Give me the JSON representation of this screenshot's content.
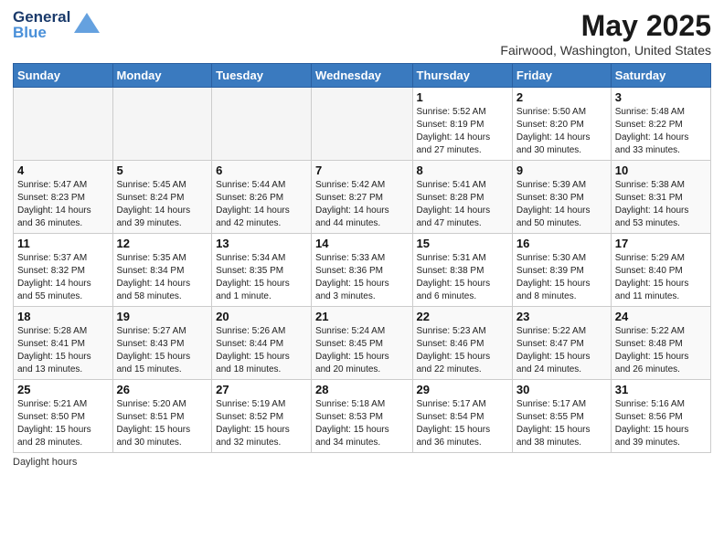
{
  "header": {
    "logo_line1": "General",
    "logo_line2": "Blue",
    "title": "May 2025",
    "subtitle": "Fairwood, Washington, United States"
  },
  "days_of_week": [
    "Sunday",
    "Monday",
    "Tuesday",
    "Wednesday",
    "Thursday",
    "Friday",
    "Saturday"
  ],
  "weeks": [
    [
      {
        "day": "",
        "info": ""
      },
      {
        "day": "",
        "info": ""
      },
      {
        "day": "",
        "info": ""
      },
      {
        "day": "",
        "info": ""
      },
      {
        "day": "1",
        "info": "Sunrise: 5:52 AM\nSunset: 8:19 PM\nDaylight: 14 hours\nand 27 minutes."
      },
      {
        "day": "2",
        "info": "Sunrise: 5:50 AM\nSunset: 8:20 PM\nDaylight: 14 hours\nand 30 minutes."
      },
      {
        "day": "3",
        "info": "Sunrise: 5:48 AM\nSunset: 8:22 PM\nDaylight: 14 hours\nand 33 minutes."
      }
    ],
    [
      {
        "day": "4",
        "info": "Sunrise: 5:47 AM\nSunset: 8:23 PM\nDaylight: 14 hours\nand 36 minutes."
      },
      {
        "day": "5",
        "info": "Sunrise: 5:45 AM\nSunset: 8:24 PM\nDaylight: 14 hours\nand 39 minutes."
      },
      {
        "day": "6",
        "info": "Sunrise: 5:44 AM\nSunset: 8:26 PM\nDaylight: 14 hours\nand 42 minutes."
      },
      {
        "day": "7",
        "info": "Sunrise: 5:42 AM\nSunset: 8:27 PM\nDaylight: 14 hours\nand 44 minutes."
      },
      {
        "day": "8",
        "info": "Sunrise: 5:41 AM\nSunset: 8:28 PM\nDaylight: 14 hours\nand 47 minutes."
      },
      {
        "day": "9",
        "info": "Sunrise: 5:39 AM\nSunset: 8:30 PM\nDaylight: 14 hours\nand 50 minutes."
      },
      {
        "day": "10",
        "info": "Sunrise: 5:38 AM\nSunset: 8:31 PM\nDaylight: 14 hours\nand 53 minutes."
      }
    ],
    [
      {
        "day": "11",
        "info": "Sunrise: 5:37 AM\nSunset: 8:32 PM\nDaylight: 14 hours\nand 55 minutes."
      },
      {
        "day": "12",
        "info": "Sunrise: 5:35 AM\nSunset: 8:34 PM\nDaylight: 14 hours\nand 58 minutes."
      },
      {
        "day": "13",
        "info": "Sunrise: 5:34 AM\nSunset: 8:35 PM\nDaylight: 15 hours\nand 1 minute."
      },
      {
        "day": "14",
        "info": "Sunrise: 5:33 AM\nSunset: 8:36 PM\nDaylight: 15 hours\nand 3 minutes."
      },
      {
        "day": "15",
        "info": "Sunrise: 5:31 AM\nSunset: 8:38 PM\nDaylight: 15 hours\nand 6 minutes."
      },
      {
        "day": "16",
        "info": "Sunrise: 5:30 AM\nSunset: 8:39 PM\nDaylight: 15 hours\nand 8 minutes."
      },
      {
        "day": "17",
        "info": "Sunrise: 5:29 AM\nSunset: 8:40 PM\nDaylight: 15 hours\nand 11 minutes."
      }
    ],
    [
      {
        "day": "18",
        "info": "Sunrise: 5:28 AM\nSunset: 8:41 PM\nDaylight: 15 hours\nand 13 minutes."
      },
      {
        "day": "19",
        "info": "Sunrise: 5:27 AM\nSunset: 8:43 PM\nDaylight: 15 hours\nand 15 minutes."
      },
      {
        "day": "20",
        "info": "Sunrise: 5:26 AM\nSunset: 8:44 PM\nDaylight: 15 hours\nand 18 minutes."
      },
      {
        "day": "21",
        "info": "Sunrise: 5:24 AM\nSunset: 8:45 PM\nDaylight: 15 hours\nand 20 minutes."
      },
      {
        "day": "22",
        "info": "Sunrise: 5:23 AM\nSunset: 8:46 PM\nDaylight: 15 hours\nand 22 minutes."
      },
      {
        "day": "23",
        "info": "Sunrise: 5:22 AM\nSunset: 8:47 PM\nDaylight: 15 hours\nand 24 minutes."
      },
      {
        "day": "24",
        "info": "Sunrise: 5:22 AM\nSunset: 8:48 PM\nDaylight: 15 hours\nand 26 minutes."
      }
    ],
    [
      {
        "day": "25",
        "info": "Sunrise: 5:21 AM\nSunset: 8:50 PM\nDaylight: 15 hours\nand 28 minutes."
      },
      {
        "day": "26",
        "info": "Sunrise: 5:20 AM\nSunset: 8:51 PM\nDaylight: 15 hours\nand 30 minutes."
      },
      {
        "day": "27",
        "info": "Sunrise: 5:19 AM\nSunset: 8:52 PM\nDaylight: 15 hours\nand 32 minutes."
      },
      {
        "day": "28",
        "info": "Sunrise: 5:18 AM\nSunset: 8:53 PM\nDaylight: 15 hours\nand 34 minutes."
      },
      {
        "day": "29",
        "info": "Sunrise: 5:17 AM\nSunset: 8:54 PM\nDaylight: 15 hours\nand 36 minutes."
      },
      {
        "day": "30",
        "info": "Sunrise: 5:17 AM\nSunset: 8:55 PM\nDaylight: 15 hours\nand 38 minutes."
      },
      {
        "day": "31",
        "info": "Sunrise: 5:16 AM\nSunset: 8:56 PM\nDaylight: 15 hours\nand 39 minutes."
      }
    ]
  ],
  "footer": {
    "daylight_label": "Daylight hours"
  }
}
